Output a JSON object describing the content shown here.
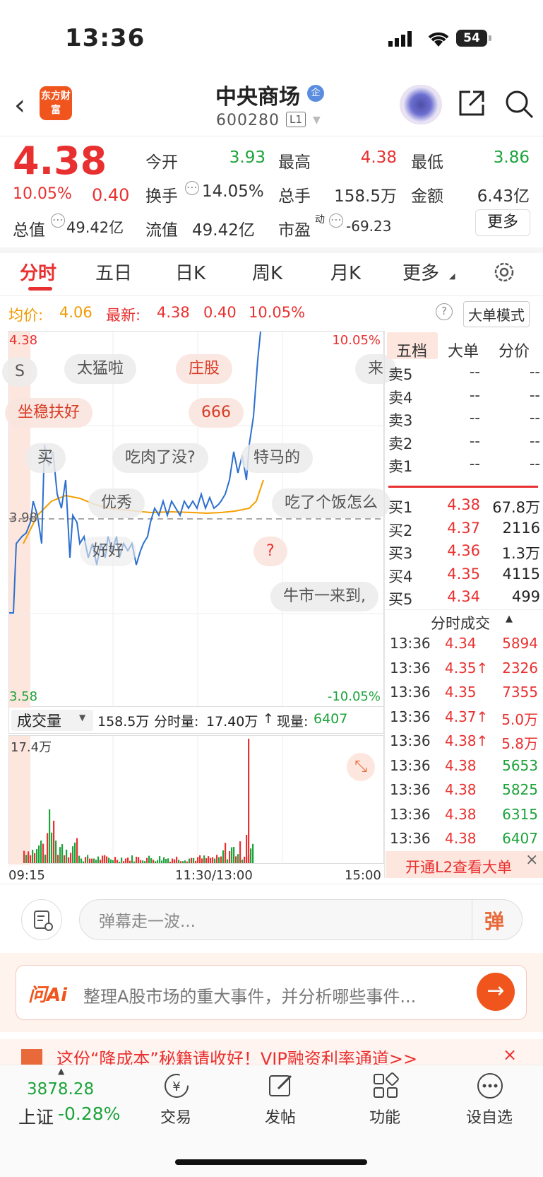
{
  "status": {
    "time": "13:36",
    "battery": "54"
  },
  "header": {
    "logo": "东方财富",
    "stock_name": "中央商场",
    "badge": "企",
    "code": "600280",
    "level": "L1"
  },
  "quote": {
    "price": "4.38",
    "pct": "10.05%",
    "change": "0.40",
    "open_label": "今开",
    "open": "3.93",
    "high_label": "最高",
    "high": "4.38",
    "low_label": "最低",
    "low": "3.86",
    "turnover_label": "换手",
    "turnover": "14.05%",
    "volume_label": "总手",
    "volume": "158.5万",
    "amount_label": "金额",
    "amount": "6.43亿",
    "mcap_label": "总值",
    "mcap": "49.42亿",
    "float_label": "流值",
    "float": "49.42亿",
    "pe_label": "市盈",
    "pe_sup": "动",
    "pe": "-69.23",
    "more": "更多"
  },
  "tabs": [
    "分时",
    "五日",
    "日K",
    "周K",
    "月K",
    "更多"
  ],
  "info": {
    "avg_label": "均价:",
    "avg": "4.06",
    "latest_label": "最新:",
    "latest": "4.38",
    "change": "0.40",
    "pct": "10.05%",
    "mode": "大单模式"
  },
  "chart": {
    "top_price": "4.38",
    "bottom_price": "3.58",
    "mid_price": "3.98",
    "top_pct": "10.05%",
    "bottom_pct": "-10.05%",
    "x_start": "09:15",
    "x_mid": "11:30/13:00",
    "x_end": "15:00",
    "vol_max": "17.4万"
  },
  "danmu": [
    "太猛啦",
    "庄股",
    "坐稳扶好",
    "666",
    "买",
    "吃肉了没?",
    "特马的",
    "优秀",
    "吃了个饭怎么",
    "好好",
    "?",
    "牛市一来到,",
    "来",
    "S"
  ],
  "volume_bar": {
    "label": "成交量",
    "total": "158.5万",
    "minute_label": "分时量:",
    "minute": "17.40万",
    "arrow": "↑",
    "current_label": "现量:",
    "current": "6407"
  },
  "orderbook": {
    "tabs": [
      "五档",
      "大单",
      "分价"
    ],
    "sells": [
      {
        "l": "卖5",
        "p": "--",
        "v": "--"
      },
      {
        "l": "卖4",
        "p": "--",
        "v": "--"
      },
      {
        "l": "卖3",
        "p": "--",
        "v": "--"
      },
      {
        "l": "卖2",
        "p": "--",
        "v": "--"
      },
      {
        "l": "卖1",
        "p": "--",
        "v": "--"
      }
    ],
    "buys": [
      {
        "l": "买1",
        "p": "4.38",
        "v": "67.8万"
      },
      {
        "l": "买2",
        "p": "4.37",
        "v": "2116"
      },
      {
        "l": "买3",
        "p": "4.36",
        "v": "1.3万"
      },
      {
        "l": "买4",
        "p": "4.35",
        "v": "4115"
      },
      {
        "l": "买5",
        "p": "4.34",
        "v": "499"
      }
    ]
  },
  "trades": {
    "title": "分时成交",
    "rows": [
      {
        "t": "13:36",
        "p": "4.34",
        "v": "5894",
        "c": "red"
      },
      {
        "t": "13:36",
        "p": "4.35↑",
        "v": "2326",
        "c": "red"
      },
      {
        "t": "13:36",
        "p": "4.35",
        "v": "7355",
        "c": "red"
      },
      {
        "t": "13:36",
        "p": "4.37↑",
        "v": "5.0万",
        "c": "red"
      },
      {
        "t": "13:36",
        "p": "4.38↑",
        "v": "5.8万",
        "c": "red"
      },
      {
        "t": "13:36",
        "p": "4.38",
        "v": "5653",
        "c": "green"
      },
      {
        "t": "13:36",
        "p": "4.38",
        "v": "5825",
        "c": "green"
      },
      {
        "t": "13:36",
        "p": "4.38",
        "v": "6315",
        "c": "green"
      },
      {
        "t": "13:36",
        "p": "4.38",
        "v": "6407",
        "c": "green"
      }
    ],
    "l2": "开通L2查看大单"
  },
  "comment": {
    "placeholder": "弹幕走一波...",
    "button": "弹"
  },
  "ai": {
    "logo": "问Ai",
    "text": "整理A股市场的重大事件，并分析哪些事件..."
  },
  "promo": {
    "text": "这份“降成本”秘籍请收好！VIP融资利率通道>>"
  },
  "nav": {
    "index_value": "3878.28",
    "index_name": "上证",
    "index_pct": "-0.28%",
    "items": [
      "交易",
      "发帖",
      "功能",
      "设自选"
    ]
  },
  "colors": {
    "up": "#e93030",
    "down": "#1ca33a",
    "accent": "#f0551d"
  }
}
